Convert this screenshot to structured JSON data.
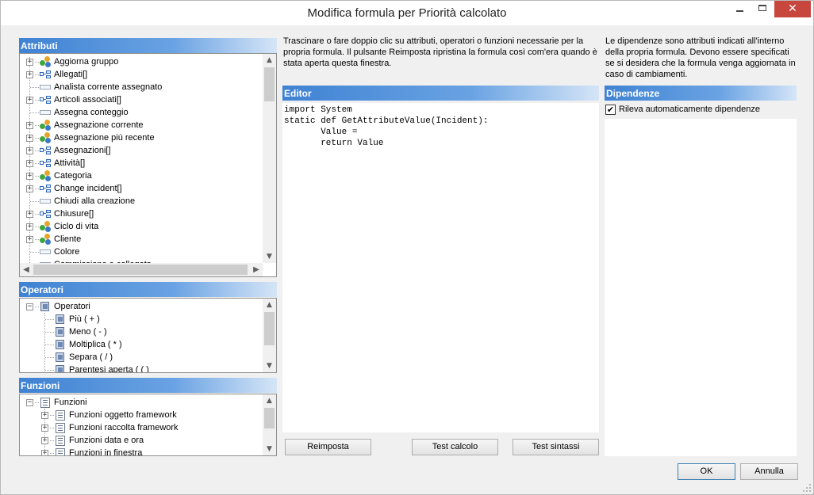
{
  "window": {
    "title": "Modifica formula per Priorità calcolato",
    "close_glyph": "✕"
  },
  "attributes": {
    "header": "Attributi",
    "items": [
      {
        "label": "Aggiorna gruppo",
        "icon": "entity-icon",
        "expandable": true
      },
      {
        "label": "Allegati[]",
        "icon": "collection-icon",
        "expandable": true
      },
      {
        "label": "Analista corrente assegnato",
        "icon": "field-icon",
        "expandable": false
      },
      {
        "label": "Articoli associati[]",
        "icon": "collection-icon",
        "expandable": true
      },
      {
        "label": "Assegna conteggio",
        "icon": "field-icon",
        "expandable": false
      },
      {
        "label": "Assegnazione corrente",
        "icon": "entity-icon",
        "expandable": true
      },
      {
        "label": "Assegnazione più recente",
        "icon": "entity-icon",
        "expandable": true
      },
      {
        "label": "Assegnazioni[]",
        "icon": "collection-icon",
        "expandable": true
      },
      {
        "label": "Attività[]",
        "icon": "collection-icon",
        "expandable": true
      },
      {
        "label": "Categoria",
        "icon": "entity-icon",
        "expandable": true
      },
      {
        "label": "Change incident[]",
        "icon": "collection-icon",
        "expandable": true
      },
      {
        "label": "Chiudi alla creazione",
        "icon": "field-icon",
        "expandable": false
      },
      {
        "label": "Chiusure[]",
        "icon": "collection-icon",
        "expandable": true
      },
      {
        "label": "Ciclo di vita",
        "icon": "entity-icon",
        "expandable": true
      },
      {
        "label": "Cliente",
        "icon": "entity-icon",
        "expandable": true
      },
      {
        "label": "Colore",
        "icon": "field-icon",
        "expandable": false
      },
      {
        "label": "Commissione e collegata",
        "icon": "field-icon",
        "expandable": false
      }
    ]
  },
  "operators": {
    "header": "Operatori",
    "root": "Operatori",
    "items": [
      "Più ( + )",
      "Meno ( - )",
      "Moltiplica ( * )",
      "Separa ( / )",
      "Parentesi aperta ( ( )"
    ]
  },
  "functions": {
    "header": "Funzioni",
    "root": "Funzioni",
    "items": [
      "Funzioni oggetto framework",
      "Funzioni raccolta framework",
      "Funzioni data e ora",
      "Funzioni in finestra"
    ]
  },
  "instructions": "Trascinare o fare doppio clic su attributi, operatori o funzioni necessarie per la propria formula. Il pulsante Reimposta ripristina la formula così com'era quando è stata aperta questa finestra.",
  "editor": {
    "header": "Editor",
    "code": "import System\nstatic def GetAttributeValue(Incident):\n       Value =\n       return Value"
  },
  "dependencies": {
    "info": "Le dipendenze sono attributi indicati all'interno della propria formula. Devono essere specificati se si desidera che la formula venga aggiornata in caso di cambiamenti.",
    "header": "Dipendenze",
    "auto_detect_label": "Rileva automaticamente dipendenze",
    "auto_detect_checked": true,
    "check_glyph": "✔"
  },
  "buttons": {
    "reset": "Reimposta",
    "test_calc": "Test calcolo",
    "test_syntax": "Test sintassi",
    "ok": "OK",
    "cancel": "Annulla"
  },
  "colors": {
    "header_blue": "#3f82d3",
    "close_red": "#c7463e"
  }
}
